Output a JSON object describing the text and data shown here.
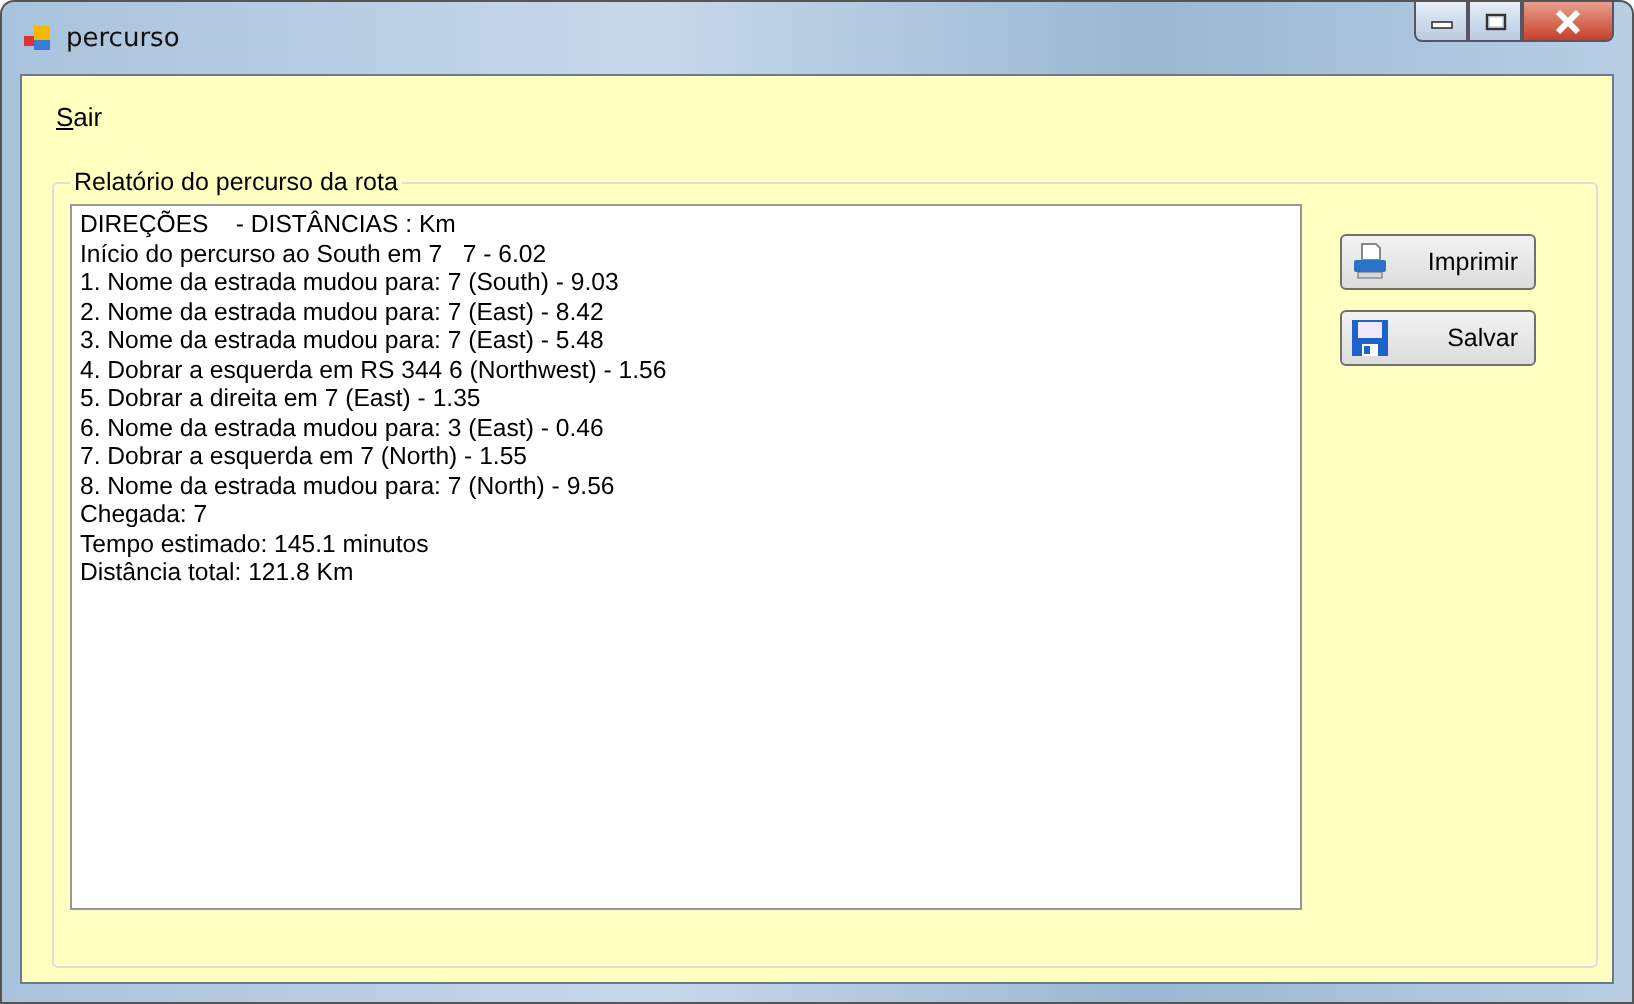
{
  "window": {
    "title": "percurso"
  },
  "menu": [
    {
      "label": "Sair"
    }
  ],
  "group": {
    "title": "Relatório do percurso da rota",
    "report_lines": [
      "DIREÇÕES    - DISTÂNCIAS : Km",
      "Início do percurso ao South em 7   7 - 6.02",
      "1. Nome da estrada mudou para: 7 (South) - 9.03",
      "2. Nome da estrada mudou para: 7 (East) - 8.42",
      "3. Nome da estrada mudou para: 7 (East) - 5.48",
      "4. Dobrar a esquerda em RS 344 6 (Northwest) - 1.56",
      "5. Dobrar a direita em 7 (East) - 1.35",
      "6. Nome da estrada mudou para: 3 (East) - 0.46",
      "7. Dobrar a esquerda em 7 (North) - 1.55",
      "8. Nome da estrada mudou para: 7 (North) - 9.56",
      "Chegada: 7",
      "Tempo estimado: 145.1 minutos",
      "Distância total: 121.8 Km"
    ],
    "buttons": [
      {
        "kind": "print",
        "label": "Imprimir"
      },
      {
        "kind": "save",
        "label": "Salvar"
      }
    ]
  }
}
